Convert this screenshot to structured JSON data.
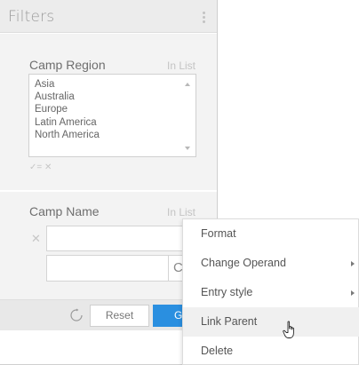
{
  "panel": {
    "title": "Filters",
    "menu_icon": "kebab-menu-icon"
  },
  "filters": [
    {
      "label": "Camp Region",
      "operator": "In List",
      "options": [
        "Asia",
        "Australia",
        "Europe",
        "Latin America",
        "North America"
      ],
      "tools": "✓= ✕"
    },
    {
      "label": "Camp Name",
      "operator": "In List",
      "clear_glyph": "✕",
      "input_value": "",
      "second_input_value": "",
      "button_glyph": "C"
    }
  ],
  "footer": {
    "reset_label": "Reset",
    "go_label": "G",
    "refresh_icon": "refresh-icon",
    "go_color": "#2a8fe0"
  },
  "context_menu": {
    "items": [
      {
        "label": "Format",
        "has_submenu": false
      },
      {
        "label": "Change Operand",
        "has_submenu": true
      },
      {
        "label": "Entry style",
        "has_submenu": true
      },
      {
        "label": "Link Parent",
        "has_submenu": false,
        "hovered": true
      },
      {
        "label": "Delete",
        "has_submenu": false
      }
    ],
    "cursor_icon": "hand-pointer-icon"
  }
}
